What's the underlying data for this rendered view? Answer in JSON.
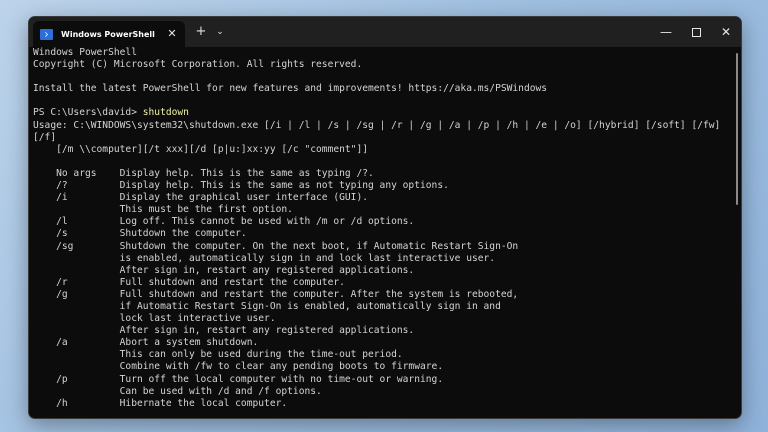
{
  "window": {
    "tab_title": "Windows PowerShell",
    "tab_close": "✕",
    "new_tab": "+",
    "dropdown": "⌄",
    "minimize": "—",
    "close": "✕"
  },
  "terminal": {
    "banner_1": "Windows PowerShell",
    "banner_2": "Copyright (C) Microsoft Corporation. All rights reserved.",
    "banner_3": "Install the latest PowerShell for new features and improvements! https://aka.ms/PSWindows",
    "prompt": "PS C:\\Users\\david> ",
    "command": "shutdown",
    "output": [
      "Usage: C:\\WINDOWS\\system32\\shutdown.exe [/i | /l | /s | /sg | /r | /g | /a | /p | /h | /e | /o] [/hybrid] [/soft] [/fw]",
      "[/f]",
      "    [/m \\\\computer][/t xxx][/d [p|u:]xx:yy [/c \"comment\"]]",
      "",
      "    No args    Display help. This is the same as typing /?.",
      "    /?         Display help. This is the same as not typing any options.",
      "    /i         Display the graphical user interface (GUI).",
      "               This must be the first option.",
      "    /l         Log off. This cannot be used with /m or /d options.",
      "    /s         Shutdown the computer.",
      "    /sg        Shutdown the computer. On the next boot, if Automatic Restart Sign-On",
      "               is enabled, automatically sign in and lock last interactive user.",
      "               After sign in, restart any registered applications.",
      "    /r         Full shutdown and restart the computer.",
      "    /g         Full shutdown and restart the computer. After the system is rebooted,",
      "               if Automatic Restart Sign-On is enabled, automatically sign in and",
      "               lock last interactive user.",
      "               After sign in, restart any registered applications.",
      "    /a         Abort a system shutdown.",
      "               This can only be used during the time-out period.",
      "               Combine with /fw to clear any pending boots to firmware.",
      "    /p         Turn off the local computer with no time-out or warning.",
      "               Can be used with /d and /f options.",
      "    /h         Hibernate the local computer."
    ]
  }
}
